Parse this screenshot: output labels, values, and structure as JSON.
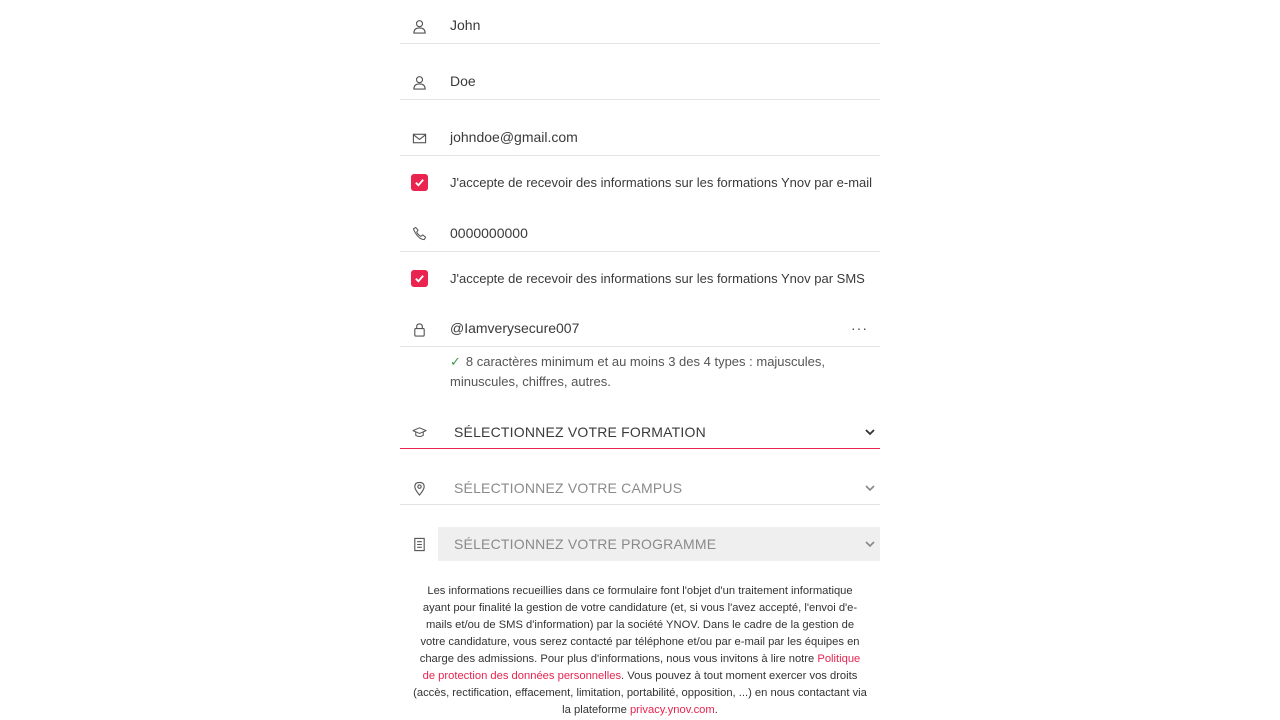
{
  "fields": {
    "first_name": "John",
    "last_name": "Doe",
    "email": "johndoe@gmail.com",
    "phone": "0000000000",
    "password": "@Iamverysecure007"
  },
  "consent": {
    "email_label": "J'accepte de recevoir des informations sur les formations Ynov par e-mail",
    "sms_label": "J'accepte de recevoir des informations sur les formations Ynov par SMS"
  },
  "password_hint": "8 caractères minimum et au moins 3 des 4 types : majuscules, minuscules, chiffres, autres.",
  "password_more": "···",
  "selects": {
    "formation": "SÉLECTIONNEZ VOTRE FORMATION",
    "campus": "SÉLECTIONNEZ VOTRE CAMPUS",
    "programme": "SÉLECTIONNEZ VOTRE PROGRAMME"
  },
  "legal": {
    "text_1": "Les informations recueillies dans ce formulaire font l'objet d'un traitement informatique ayant pour finalité la gestion de votre candidature (et, si vous l'avez accepté, l'envoi d'e-mails et/ou de SMS d'information) par la société YNOV. Dans le cadre de la gestion de votre candidature, vous serez contacté par téléphone et/ou par e-mail par les équipes en charge des admissions. Pour plus d'informations, nous vous invitons à lire notre ",
    "link_policy": "Politique de protection des données personnelles",
    "text_2": ". Vous pouvez à tout moment exercer vos droits (accès, rectification, effacement, limitation, portabilité, opposition, ...) en nous contactant via la plateforme ",
    "link_privacy": "privacy.ynov.com",
    "text_3": "."
  },
  "colors": {
    "accent": "#e8244f",
    "success": "#3a9a4a",
    "disabled_bg": "#efefef",
    "muted_text": "#8a8a8a"
  }
}
